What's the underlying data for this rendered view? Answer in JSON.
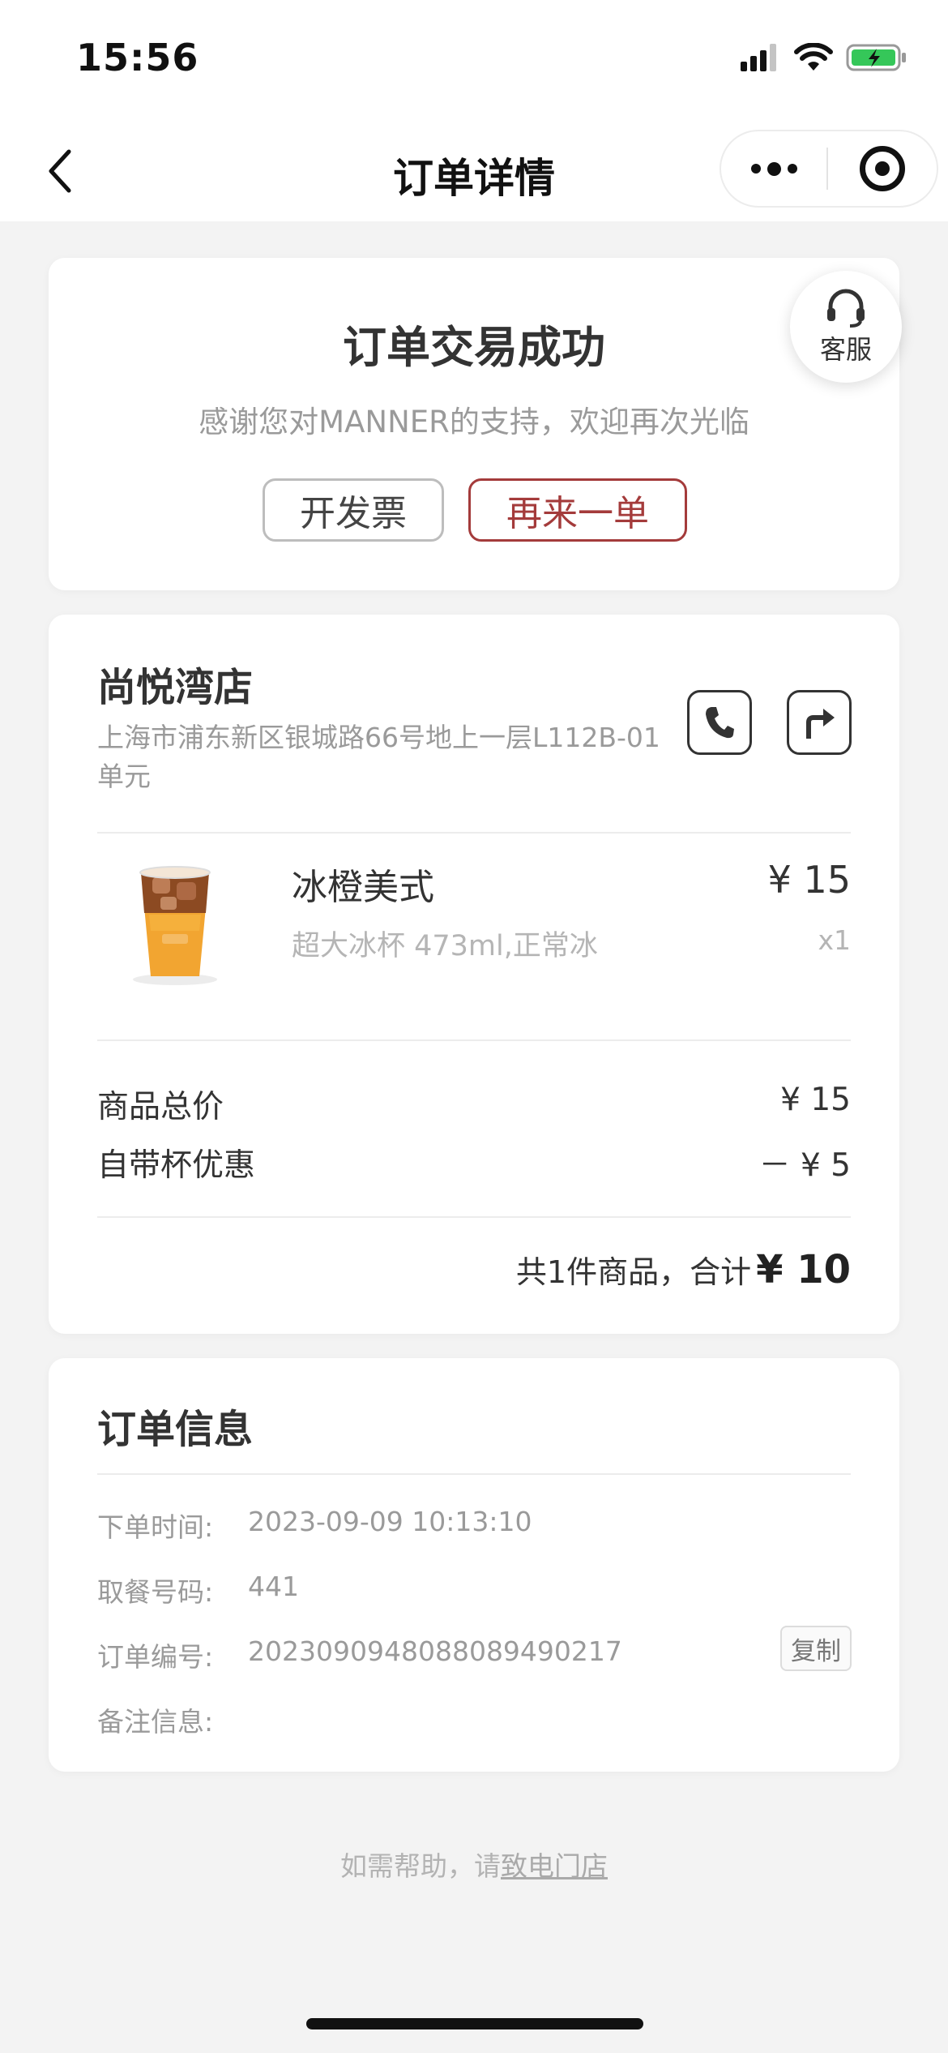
{
  "status_bar": {
    "time": "15:56"
  },
  "nav": {
    "title": "订单详情"
  },
  "status_card": {
    "title": "订单交易成功",
    "subtitle": "感谢您对MANNER的支持，欢迎再次光临",
    "invoice_button": "开发票",
    "reorder_button": "再来一单"
  },
  "service_button": {
    "label": "客服",
    "icon": "headset-icon"
  },
  "store": {
    "name": "尚悦湾店",
    "address": "上海市浦东新区银城路66号地上一层L112B-01单元",
    "phone_icon": "phone-icon",
    "navigate_icon": "navigate-icon"
  },
  "product": {
    "name": "冰橙美式",
    "spec": "超大冰杯 473ml,正常冰",
    "price": "¥ 15",
    "quantity": "x1"
  },
  "price_summary": {
    "subtotal_label": "商品总价",
    "subtotal_value": "¥ 15",
    "discount_label": "自带杯优惠",
    "discount_value": "－ ¥ 5",
    "total_prefix": "共1件商品，合计",
    "total_value": "¥ 10"
  },
  "order_info": {
    "title": "订单信息",
    "time_label": "下单时间:",
    "time_value": "2023-09-09 10:13:10",
    "pickup_label": "取餐号码:",
    "pickup_value": "441",
    "number_label": "订单编号:",
    "number_value": "2023090948088089490217",
    "copy_button": "复制",
    "remark_label": "备注信息:"
  },
  "footer": {
    "help_prefix": "如需帮助，请",
    "help_link": "致电门店"
  },
  "colors": {
    "accent": "#a43b3b",
    "background": "#f3f3f3"
  }
}
